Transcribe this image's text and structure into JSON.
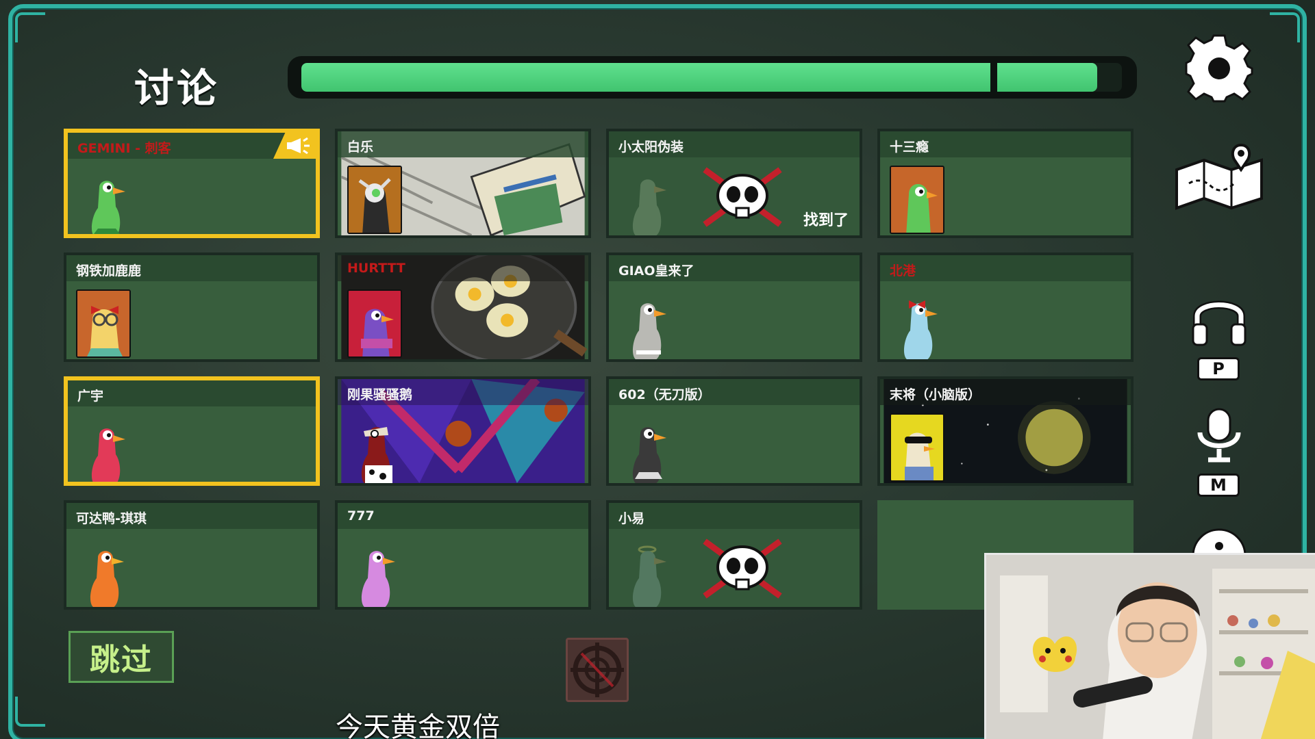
{
  "screen": {
    "title": "讨论",
    "timer_progress": 0.97,
    "timer_segment_split": 0.84
  },
  "players": [
    {
      "name": "GEMINI - 刺客",
      "name_color": "red",
      "highlight": true,
      "megaphone": true,
      "avatar": "green-goose",
      "dead": false
    },
    {
      "name": "白乐",
      "avatar": "portrait-robot-goose",
      "background": "cartoon-billboard",
      "dead": false
    },
    {
      "name": "小太阳伪装",
      "avatar": "faded-goose",
      "dead": true,
      "status_text": "找到了"
    },
    {
      "name": "十三瘾",
      "avatar": "portrait-green-goose",
      "dead": false
    },
    {
      "name": "钢铁加鹿鹿",
      "avatar": "portrait-yellow-goose-glasses",
      "dead": false
    },
    {
      "name": "HURTTT",
      "name_color": "red",
      "avatar": "portrait-purple-goose",
      "background": "fried-eggs-pan",
      "dead": false
    },
    {
      "name": "GIAO皇来了",
      "avatar": "grey-goose",
      "dead": false
    },
    {
      "name": "北港",
      "name_color": "red",
      "avatar": "lightblue-goose-bow",
      "dead": false
    },
    {
      "name": "广宇",
      "highlight": true,
      "avatar": "red-goose",
      "dead": false
    },
    {
      "name": "刚果骚骚鹅",
      "avatar": "cow-goose-hat",
      "background": "purple-diamond",
      "dead": false
    },
    {
      "name": "602（无刀版）",
      "avatar": "dark-goose",
      "dead": false
    },
    {
      "name": "末将（小脑版）",
      "avatar": "portrait-sunglasses-goose",
      "background": "night-moon",
      "dead": false
    },
    {
      "name": "可达鸭-琪琪",
      "avatar": "orange-goose",
      "dead": false
    },
    {
      "name": "777",
      "avatar": "pink-goose",
      "dead": false
    },
    {
      "name": "小易",
      "avatar": "faded-goose-halo",
      "dead": true
    },
    {
      "name": "",
      "empty": true
    }
  ],
  "controls": {
    "skip_label": "跳过",
    "push_to_talk_key": "P",
    "mute_key": "M",
    "icons": [
      "gear-icon",
      "map-icon",
      "headphones-icon",
      "microphone-icon",
      "info-icon",
      "crosshair-icon"
    ]
  },
  "subtitle": "今天黄金双倍",
  "colors": {
    "frame": "#2fb3a3",
    "card": "#385e3d",
    "highlight": "#f2c31f",
    "timer": "#4ccf7a",
    "name_red": "#c41a1a"
  }
}
